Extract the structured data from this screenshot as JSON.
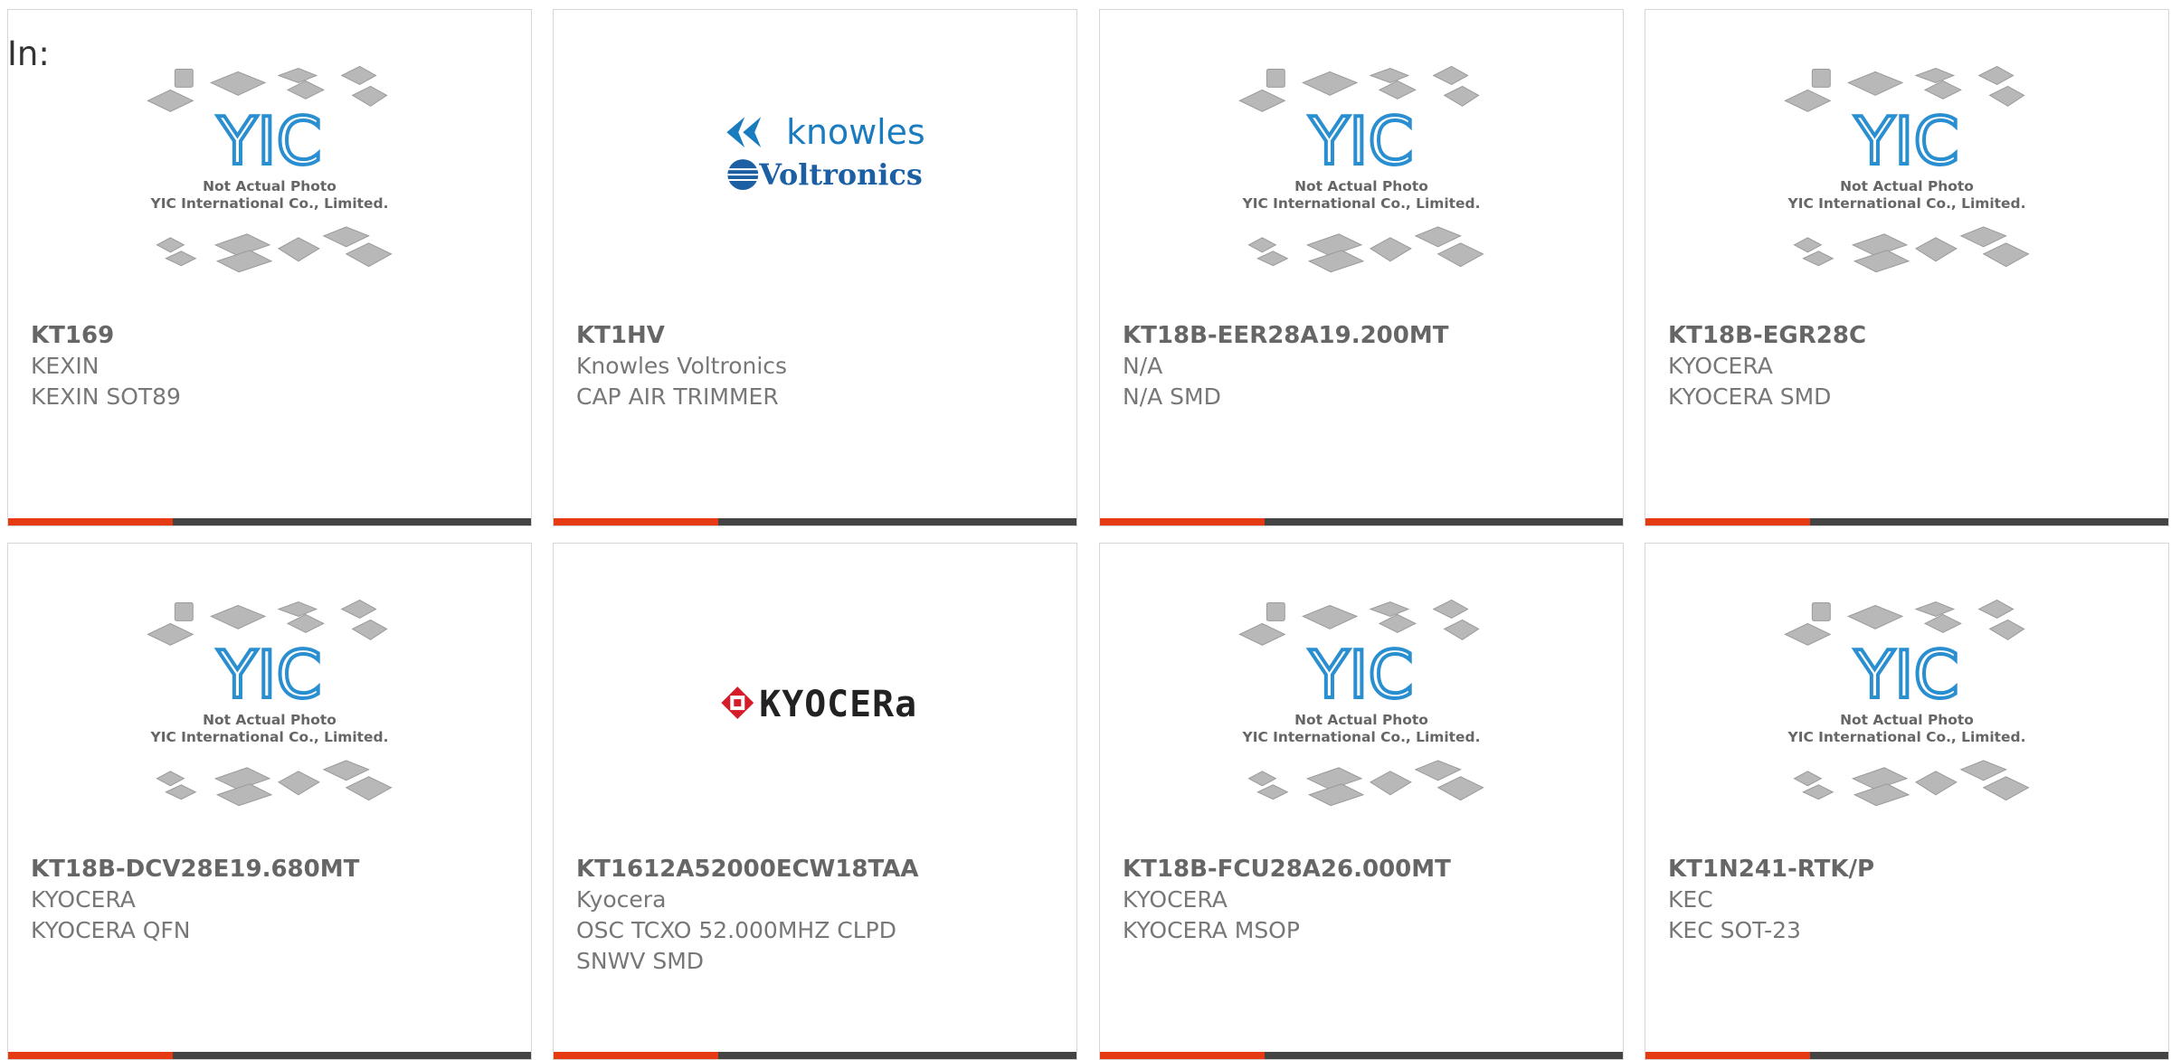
{
  "filter_label": "In:",
  "colors": {
    "accent": "#e63a12",
    "bar": "#444444",
    "yic_blue": "#2a8fd0"
  },
  "placeholder_image": {
    "line1": "Not Actual Photo",
    "line2": "YIC International Co., Limited."
  },
  "logos": {
    "knowles": {
      "line1": "knowles",
      "line2": "Voltronics"
    },
    "kyocera": {
      "text": "KYOCERa"
    }
  },
  "products": [
    {
      "part": "KT169",
      "manufacturer": "KEXIN",
      "desc": "KEXIN SOT89",
      "desc2": "",
      "image": "yic-placeholder"
    },
    {
      "part": "KT1HV",
      "manufacturer": "Knowles Voltronics",
      "desc": "CAP AIR TRIMMER",
      "desc2": "",
      "image": "knowles-logo"
    },
    {
      "part": "KT18B-EER28A19.200MT",
      "manufacturer": "N/A",
      "desc": "N/A SMD",
      "desc2": "",
      "image": "yic-placeholder"
    },
    {
      "part": "KT18B-EGR28C",
      "manufacturer": "KYOCERA",
      "desc": "KYOCERA SMD",
      "desc2": "",
      "image": "yic-placeholder"
    },
    {
      "part": "KT18B-DCV28E19.680MT",
      "manufacturer": "KYOCERA",
      "desc": "KYOCERA QFN",
      "desc2": "",
      "image": "yic-placeholder"
    },
    {
      "part": "KT1612A52000ECW18TAA",
      "manufacturer": "Kyocera",
      "desc": "OSC TCXO 52.000MHZ CLPD",
      "desc2": "SNWV SMD",
      "image": "kyocera-logo"
    },
    {
      "part": "KT18B-FCU28A26.000MT",
      "manufacturer": "KYOCERA",
      "desc": "KYOCERA MSOP",
      "desc2": "",
      "image": "yic-placeholder"
    },
    {
      "part": "KT1N241-RTK/P",
      "manufacturer": "KEC",
      "desc": "KEC SOT-23",
      "desc2": "",
      "image": "yic-placeholder"
    }
  ]
}
